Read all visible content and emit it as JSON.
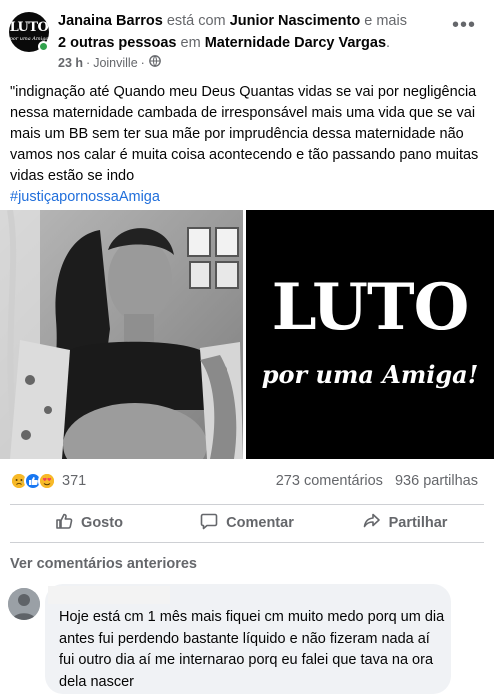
{
  "post": {
    "author": "Janaina Barros",
    "with_text": "está com",
    "tagged": "Junior Nascimento",
    "and_more": "e mais",
    "others": "2 outras pessoas",
    "at_text": "em",
    "place": "Maternidade Darcy Vargas",
    "place_end": ".",
    "time": "23 h",
    "separator": "·",
    "location": "Joinville",
    "separator2": "·",
    "privacy_icon": "globe-icon",
    "avatar_text_big": "LUTO",
    "avatar_text_small": "por uma Amiga",
    "text": "\"indignação até Quando meu Deus Quantas vidas se vai por negligência nessa maternidade cambada de irresponsável mais uma vida que se vai mais um BB sem ter sua mãe por imprudência dessa maternidade não vamos nos calar é muita coisa acontecendo e tão passando pano muitas vidas estão se indo",
    "hashtag": "#justiçapornossaAmiga",
    "image_right": {
      "title": "LUTO",
      "subtitle": "por uma Amiga!"
    }
  },
  "stats": {
    "reaction_icons": [
      "sad-icon",
      "like-icon",
      "love-icon"
    ],
    "reaction_count": "371",
    "comments": "273 comentários",
    "shares": "936 partilhas"
  },
  "actions": {
    "like": "Gosto",
    "comment": "Comentar",
    "share": "Partilhar"
  },
  "comments": {
    "view_previous": "Ver comentários anteriores",
    "first": {
      "text": "Hoje está cm 1 mês mais fiquei cm muito medo porq um dia antes fui perdendo bastante líquido e não fizeram nada aí fui outro dia aí me internarao porq eu falei que tava na ora dela nascer"
    }
  },
  "colors": {
    "link_blue": "#216fdb",
    "secondary_text": "#65676b",
    "online_green": "#31a24c",
    "like_blue": "#1877f2",
    "bubble_bg": "#f0f2f5"
  }
}
